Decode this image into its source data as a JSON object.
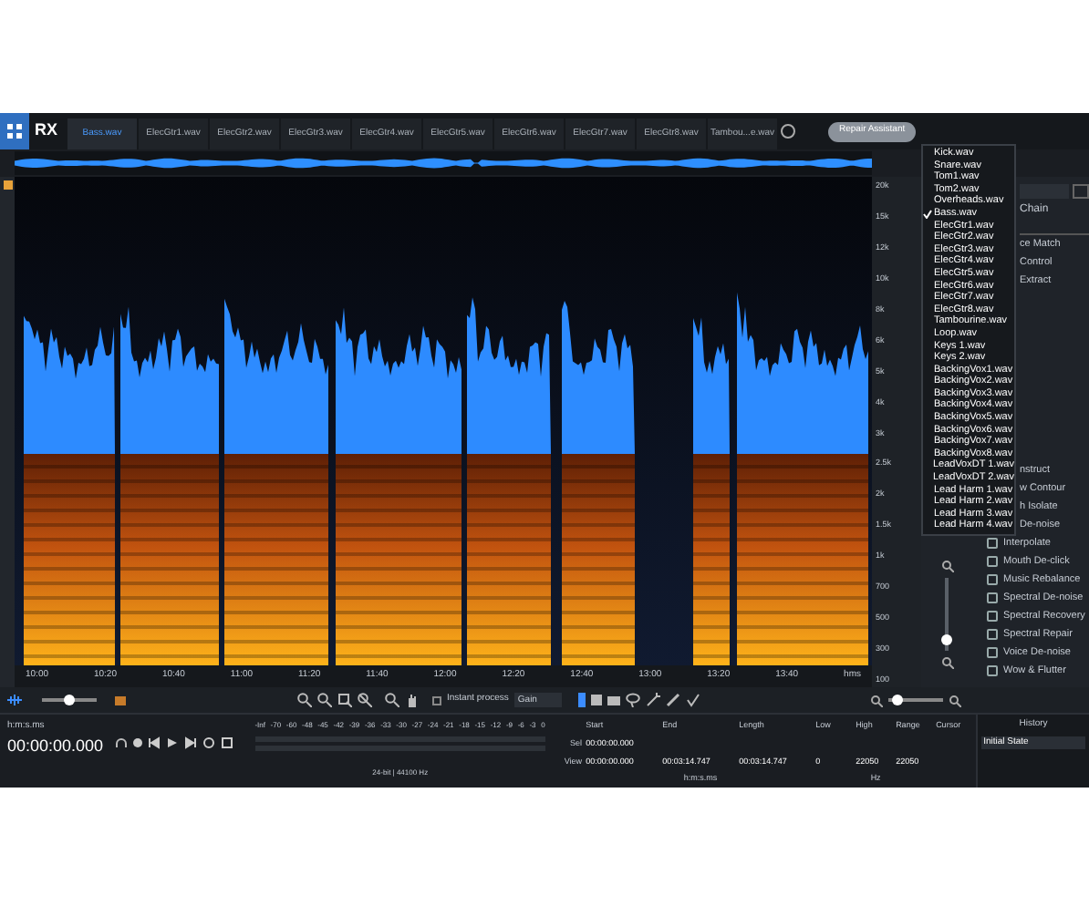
{
  "app": {
    "logo": "RX"
  },
  "tabs": [
    {
      "label": "Bass.wav",
      "selected": true
    },
    {
      "label": "ElecGtr1.wav",
      "selected": false
    },
    {
      "label": "ElecGtr2.wav",
      "selected": false
    },
    {
      "label": "ElecGtr3.wav",
      "selected": false
    },
    {
      "label": "ElecGtr4.wav",
      "selected": false
    },
    {
      "label": "ElecGtr5.wav",
      "selected": false
    },
    {
      "label": "ElecGtr6.wav",
      "selected": false
    },
    {
      "label": "ElecGtr7.wav",
      "selected": false
    },
    {
      "label": "ElecGtr8.wav",
      "selected": false
    },
    {
      "label": "Tambou...e.wav",
      "selected": false
    }
  ],
  "repair_button": "Repair Assistant",
  "file_menu": {
    "items": [
      {
        "label": "Kick.wav",
        "checked": false
      },
      {
        "label": "Snare.wav",
        "checked": false
      },
      {
        "label": "Tom1.wav",
        "checked": false
      },
      {
        "label": "Tom2.wav",
        "checked": false
      },
      {
        "label": "Overheads.wav",
        "checked": false
      },
      {
        "label": "Bass.wav",
        "checked": true
      },
      {
        "label": "ElecGtr1.wav",
        "checked": false
      },
      {
        "label": "ElecGtr2.wav",
        "checked": false
      },
      {
        "label": "ElecGtr3.wav",
        "checked": false
      },
      {
        "label": "ElecGtr4.wav",
        "checked": false
      },
      {
        "label": "ElecGtr5.wav",
        "checked": false
      },
      {
        "label": "ElecGtr6.wav",
        "checked": false
      },
      {
        "label": "ElecGtr7.wav",
        "checked": false
      },
      {
        "label": "ElecGtr8.wav",
        "checked": false
      },
      {
        "label": "Tambourine.wav",
        "checked": false
      },
      {
        "label": "Loop.wav",
        "checked": false
      },
      {
        "label": "Keys 1.wav",
        "checked": false
      },
      {
        "label": "Keys 2.wav",
        "checked": false
      },
      {
        "label": "BackingVox1.wav",
        "checked": false
      },
      {
        "label": "BackingVox2.wav",
        "checked": false
      },
      {
        "label": "BackingVox3.wav",
        "checked": false
      },
      {
        "label": "BackingVox4.wav",
        "checked": false
      },
      {
        "label": "BackingVox5.wav",
        "checked": false
      },
      {
        "label": "BackingVox6.wav",
        "checked": false
      },
      {
        "label": "BackingVox7.wav",
        "checked": false
      },
      {
        "label": "BackingVox8.wav",
        "checked": false
      },
      {
        "label": "LeadVoxDT 1.wav",
        "checked": false
      },
      {
        "label": "LeadVoxDT 2.wav",
        "checked": false
      },
      {
        "label": "Lead Harm 1.wav",
        "checked": false
      },
      {
        "label": "Lead Harm 2.wav",
        "checked": false
      },
      {
        "label": "Lead Harm 3.wav",
        "checked": false
      },
      {
        "label": "Lead Harm 4.wav",
        "checked": false
      }
    ]
  },
  "spectrogram": {
    "time_labels": [
      "10:00",
      "10:20",
      "10:40",
      "11:00",
      "11:20",
      "11:40",
      "12:00",
      "12:20",
      "12:40",
      "13:00",
      "13:20",
      "13:40",
      "hms"
    ],
    "freq_labels": [
      "20k",
      "15k",
      "12k",
      "10k",
      "8k",
      "6k",
      "5k",
      "4k",
      "3k",
      "2.5k",
      "2k",
      "1.5k",
      "1k",
      "700",
      "500",
      "300",
      "100"
    ],
    "zoom_slider": {
      "level": 0.1
    }
  },
  "module_panel": {
    "top_label": "Chain",
    "modules_top": [
      "ce Match",
      "Control",
      "Extract"
    ],
    "modules_middle": [
      "nstruct",
      "w Contour",
      "h Isolate",
      "De-noise"
    ],
    "modules": [
      {
        "label": "Interpolate",
        "kind": "module"
      },
      {
        "label": "Mouth De-click",
        "kind": "module"
      },
      {
        "label": "Music Rebalance",
        "kind": "module"
      },
      {
        "label": "Spectral De-noise",
        "kind": "module"
      },
      {
        "label": "Spectral Recovery",
        "kind": "module"
      },
      {
        "label": "Spectral Repair",
        "kind": "module"
      },
      {
        "label": "Voice De-noise",
        "kind": "module"
      },
      {
        "label": "Wow & Flutter",
        "kind": "module"
      }
    ]
  },
  "toolbar": {
    "opacity_slider": {
      "level": 0.5
    },
    "instant_process": {
      "label": "Instant process",
      "checked": false
    },
    "mode": "Gain",
    "time_zoom_slider": {
      "level": 0.1
    }
  },
  "transport": {
    "format": "h:m:s.ms",
    "time": "00:00:00.000"
  },
  "meter": {
    "scale": [
      "-Inf",
      "-70",
      "-60",
      "-48",
      "-45",
      "-42",
      "-39",
      "-36",
      "-33",
      "-30",
      "-27",
      "-24",
      "-21",
      "-18",
      "-15",
      "-12",
      "-9",
      "-6",
      "-3",
      "0"
    ],
    "info": "24-bit | 44100 Hz"
  },
  "selection": {
    "columns": [
      "Start",
      "End",
      "Length",
      "Low",
      "High",
      "Range",
      "Cursor"
    ],
    "rows": [
      {
        "label": "Sel",
        "start": "00:00:00.000"
      },
      {
        "label": "View",
        "start": "00:00:00.000",
        "end": "00:03:14.747",
        "length": "00:03:14.747",
        "low": "0",
        "high": "22050",
        "range": "22050"
      }
    ],
    "units": [
      "h:m:s.ms",
      "Hz"
    ]
  },
  "history": {
    "title": "History",
    "items": [
      {
        "label": "Initial State",
        "selected": true
      }
    ]
  }
}
